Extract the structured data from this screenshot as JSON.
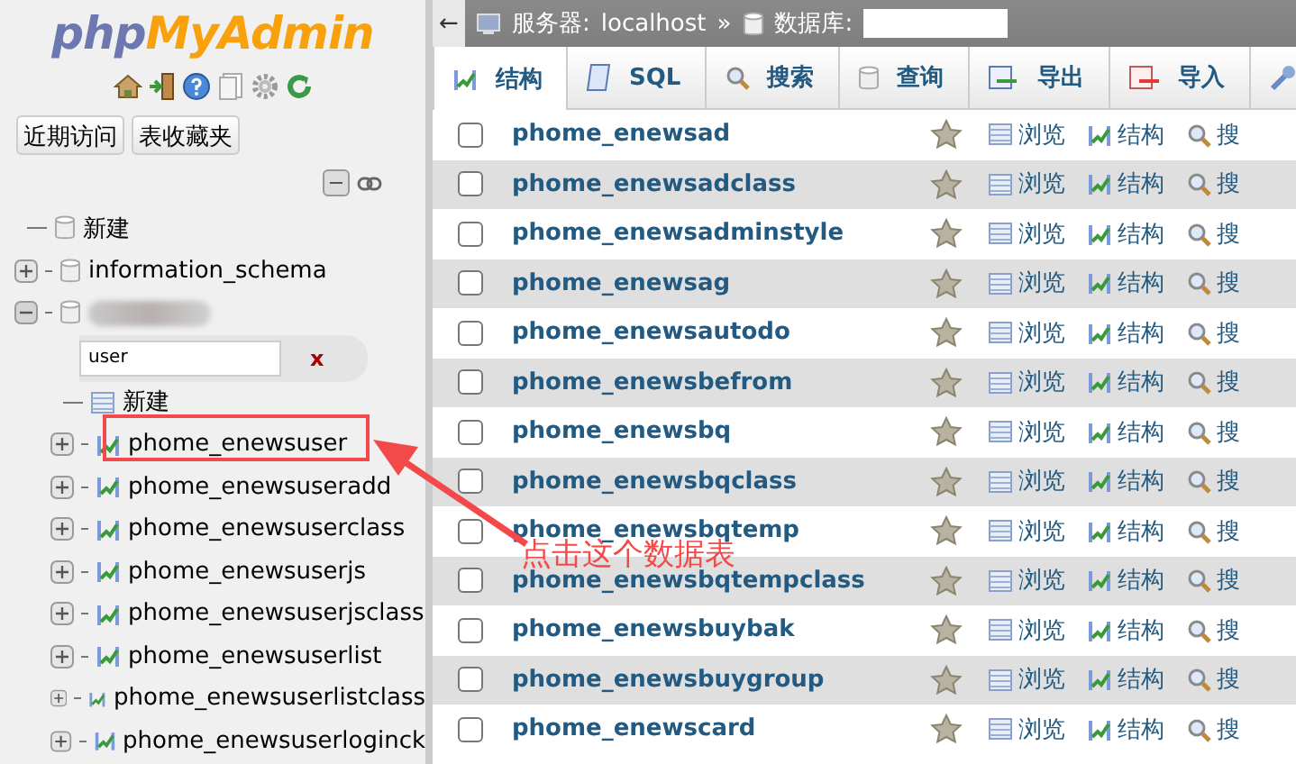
{
  "sidebar": {
    "logo": {
      "part_1": "php",
      "part_2": "MyAdmin"
    },
    "buttons": [
      "近期访问",
      "表收藏夹"
    ],
    "tree": [
      {
        "label": "新建",
        "kind": "new"
      },
      {
        "label": "information_schema",
        "kind": "db",
        "expanded": false
      },
      {
        "kind": "db",
        "expanded": true,
        "filter": {
          "value": "user",
          "clear": "x"
        },
        "children": [
          {
            "label": "新建",
            "kind": "new-table"
          },
          {
            "label": "phome_enewsuser",
            "kind": "table",
            "expanded": false
          },
          {
            "label": "phome_enewsuseradd",
            "kind": "table",
            "expanded": false
          },
          {
            "label": "phome_enewsuserclass",
            "kind": "table",
            "expanded": false
          },
          {
            "label": "phome_enewsuserjs",
            "kind": "table",
            "expanded": false
          },
          {
            "label": "phome_enewsuserjsclass",
            "kind": "table",
            "expanded": false
          },
          {
            "label": "phome_enewsuserlist",
            "kind": "table",
            "expanded": false
          },
          {
            "label": "phome_enewsuserlistclass",
            "kind": "table",
            "expanded": false
          },
          {
            "label": "phome_enewsuserloginck",
            "kind": "table",
            "expanded": false
          }
        ]
      }
    ]
  },
  "breadcrumb": {
    "back": "←",
    "server_label": "服务器:",
    "server": "localhost",
    "separator": "»",
    "db_label": "数据库:"
  },
  "tabs": [
    {
      "label": "结构",
      "kind": "structure",
      "selected": true
    },
    {
      "label": "SQL",
      "kind": "sql",
      "selected": false
    },
    {
      "label": "搜索",
      "kind": "search",
      "selected": false
    },
    {
      "label": "查询",
      "kind": "query",
      "selected": false
    },
    {
      "label": "导出",
      "kind": "export",
      "selected": false
    },
    {
      "label": "导入",
      "kind": "import",
      "selected": false
    },
    {
      "kind": "operations",
      "selected": false
    }
  ],
  "table": {
    "rows": [
      {
        "name": "phome_enewsad",
        "checked": false,
        "browse": "浏览",
        "structure": "结构",
        "search": "搜"
      },
      {
        "name": "phome_enewsadclass",
        "checked": false,
        "browse": "浏览",
        "structure": "结构",
        "search": "搜"
      },
      {
        "name": "phome_enewsadminstyle",
        "checked": false,
        "browse": "浏览",
        "structure": "结构",
        "search": "搜"
      },
      {
        "name": "phome_enewsag",
        "checked": false,
        "browse": "浏览",
        "structure": "结构",
        "search": "搜"
      },
      {
        "name": "phome_enewsautodo",
        "checked": false,
        "browse": "浏览",
        "structure": "结构",
        "search": "搜"
      },
      {
        "name": "phome_enewsbefrom",
        "checked": false,
        "browse": "浏览",
        "structure": "结构",
        "search": "搜"
      },
      {
        "name": "phome_enewsbq",
        "checked": false,
        "browse": "浏览",
        "structure": "结构",
        "search": "搜"
      },
      {
        "name": "phome_enewsbqclass",
        "checked": false,
        "browse": "浏览",
        "structure": "结构",
        "search": "搜"
      },
      {
        "name": "phome_enewsbqtemp",
        "checked": false,
        "browse": "浏览",
        "structure": "结构",
        "search": "搜"
      },
      {
        "name": "phome_enewsbqtempclass",
        "checked": false,
        "browse": "浏览",
        "structure": "结构",
        "search": "搜"
      },
      {
        "name": "phome_enewsbuybak",
        "checked": false,
        "browse": "浏览",
        "structure": "结构",
        "search": "搜"
      },
      {
        "name": "phome_enewsbuygroup",
        "checked": false,
        "browse": "浏览",
        "structure": "结构",
        "search": "搜"
      },
      {
        "name": "phome_enewscard",
        "checked": false,
        "browse": "浏览",
        "structure": "结构",
        "search": "搜"
      }
    ]
  },
  "annotation": {
    "text": "点击这个数据表",
    "color": "#f4494b"
  }
}
